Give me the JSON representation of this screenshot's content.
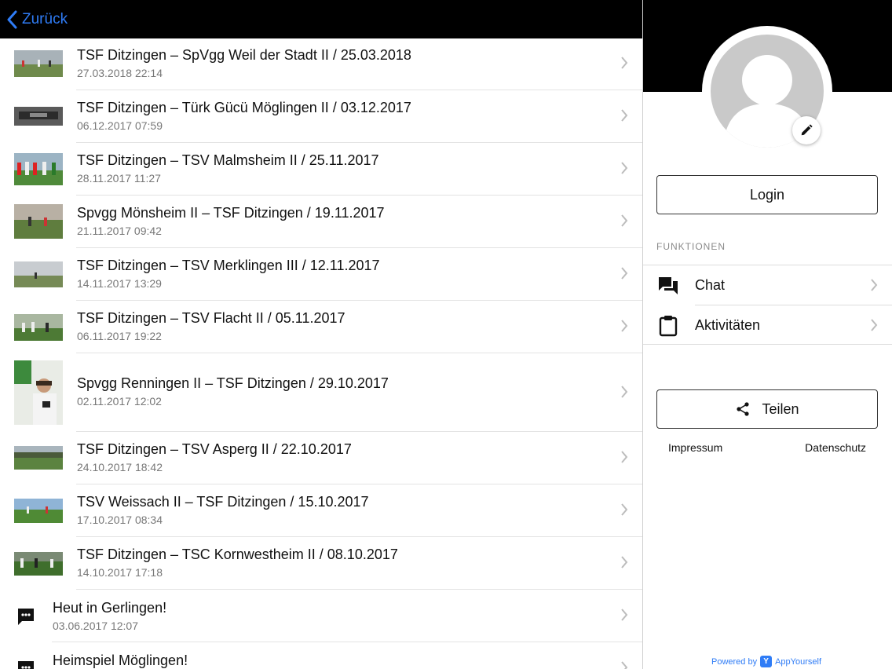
{
  "navbar": {
    "back_label": "Zurück"
  },
  "list": [
    {
      "kind": "photo",
      "title": "TSF Ditzingen – SpVgg Weil der Stadt II / 25.03.2018",
      "date": "27.03.2018 22:14"
    },
    {
      "kind": "photo",
      "title": "TSF Ditzingen – Türk Gücü Möglingen II / 03.12.2017",
      "date": "06.12.2017 07:59"
    },
    {
      "kind": "photo",
      "title": "TSF Ditzingen – TSV Malmsheim II / 25.11.2017",
      "date": "28.11.2017 11:27"
    },
    {
      "kind": "photo",
      "title": "Spvgg Mönsheim II – TSF Ditzingen / 19.11.2017",
      "date": "21.11.2017 09:42"
    },
    {
      "kind": "photo",
      "title": "TSF Ditzingen – TSV Merklingen III / 12.11.2017",
      "date": "14.11.2017 13:29"
    },
    {
      "kind": "photo",
      "title": "TSF Ditzingen – TSV Flacht II / 05.11.2017",
      "date": "06.11.2017 19:22"
    },
    {
      "kind": "photo",
      "title": "Spvgg Renningen II – TSF Ditzingen / 29.10.2017",
      "date": "02.11.2017 12:02"
    },
    {
      "kind": "photo",
      "title": "TSF Ditzingen – TSV Asperg II / 22.10.2017",
      "date": "24.10.2017 18:42"
    },
    {
      "kind": "photo",
      "title": "TSV Weissach II – TSF Ditzingen / 15.10.2017",
      "date": "17.10.2017 08:34"
    },
    {
      "kind": "photo",
      "title": "TSF Ditzingen – TSC Kornwestheim II / 08.10.2017",
      "date": "14.10.2017 17:18"
    },
    {
      "kind": "message",
      "title": "Heut in Gerlingen!",
      "date": "03.06.2017 12:07"
    },
    {
      "kind": "message",
      "title": "Heimspiel Möglingen!",
      "date": ""
    }
  ],
  "profile": {
    "login_label": "Login",
    "section_heading": "FUNKTIONEN",
    "functions": [
      {
        "label": "Chat",
        "icon": "chat-icon"
      },
      {
        "label": "Aktivitäten",
        "icon": "clipboard-icon"
      }
    ],
    "share_label": "Teilen",
    "impressum_label": "Impressum",
    "datenschutz_label": "Datenschutz",
    "powered_prefix": "Powered by",
    "powered_brand": "AppYourself"
  },
  "colors": {
    "accent": "#2f7cf6",
    "navbar": "#000000"
  }
}
